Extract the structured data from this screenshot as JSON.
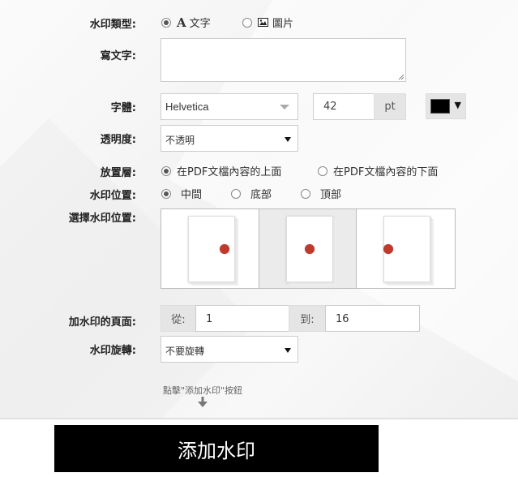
{
  "watermark_type": {
    "label": "水印類型:",
    "options": [
      {
        "label": "文字",
        "icon": "text-a-icon",
        "selected": true
      },
      {
        "label": "圖片",
        "icon": "image-icon",
        "selected": false
      }
    ]
  },
  "text_field": {
    "label": "寫文字:",
    "value": ""
  },
  "font": {
    "label": "字體:",
    "family": "Helvetica",
    "size": "42",
    "unit": "pt",
    "color": "#000000"
  },
  "opacity": {
    "label": "透明度:",
    "selected": "不透明"
  },
  "layer": {
    "label": "放置層:",
    "options": [
      {
        "label": "在PDF文檔內容的上面",
        "selected": true
      },
      {
        "label": "在PDF文檔內容的下面",
        "selected": false
      }
    ]
  },
  "position": {
    "label": "水印位置:",
    "options": [
      {
        "label": "中間",
        "selected": true
      },
      {
        "label": "底部",
        "selected": false
      },
      {
        "label": "頂部",
        "selected": false
      }
    ]
  },
  "position_picker": {
    "label": "選擇水印位置:",
    "selected_index": 1,
    "marker_color": "#c0392b"
  },
  "pages": {
    "label": "加水印的頁面:",
    "from_label": "從:",
    "from": "1",
    "to_label": "到:",
    "to": "16"
  },
  "rotation": {
    "label": "水印旋轉:",
    "selected": "不要旋轉"
  },
  "hint": "點擊\"添加水印\"按鈕",
  "submit_label": "添加水印"
}
